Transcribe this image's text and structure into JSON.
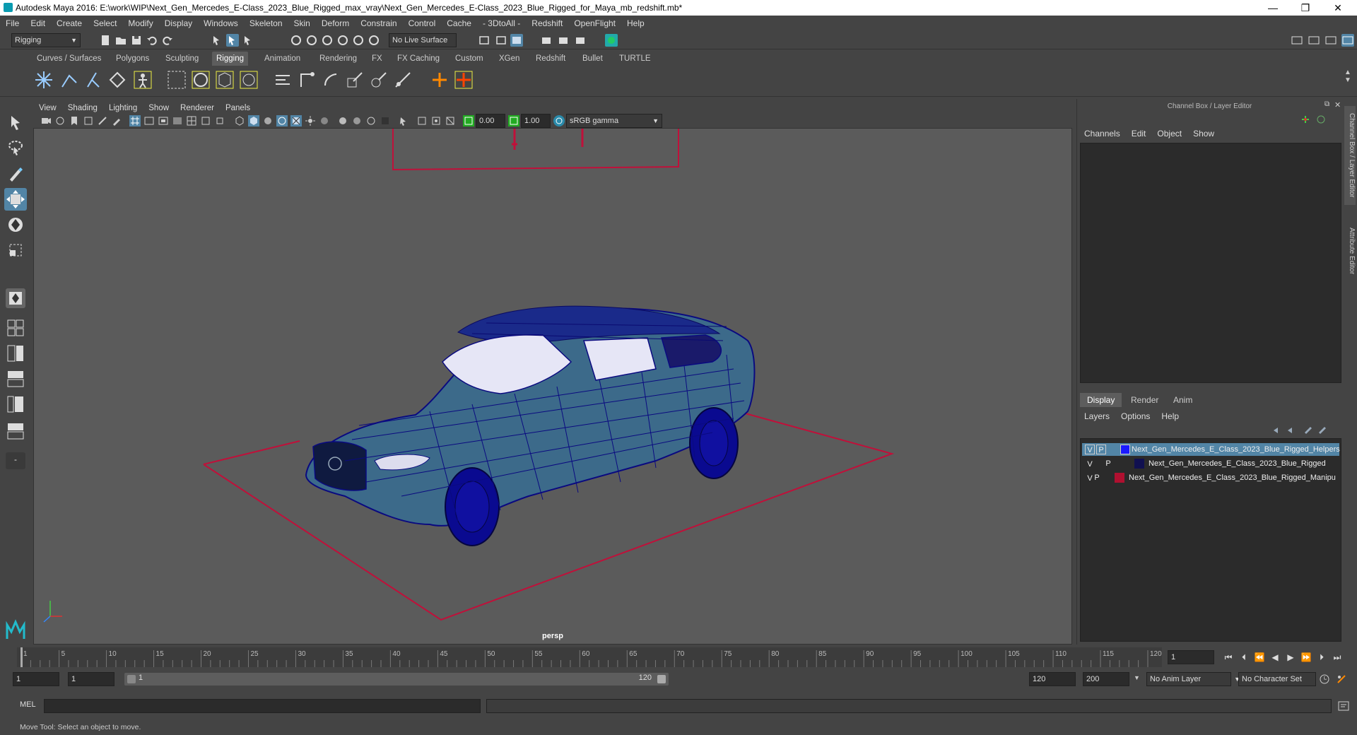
{
  "window": {
    "title": "Autodesk Maya 2016: E:\\work\\WIP\\Next_Gen_Mercedes_E-Class_2023_Blue_Rigged_max_vray\\Next_Gen_Mercedes_E-Class_2023_Blue_Rigged_for_Maya_mb_redshift.mb*",
    "minimize": "—",
    "restore": "❐",
    "close": "✕"
  },
  "menubar": [
    "File",
    "Edit",
    "Create",
    "Select",
    "Modify",
    "Display",
    "Windows",
    "Skeleton",
    "Skin",
    "Deform",
    "Constrain",
    "Control",
    "Cache",
    "- 3DtoAll -",
    "Redshift",
    "OpenFlight",
    "Help"
  ],
  "statusline": {
    "menuset": "Rigging",
    "live_surface": "No Live Surface"
  },
  "shelf_tabs": [
    "Curves / Surfaces",
    "Polygons",
    "Sculpting",
    "Rigging",
    "Animation",
    "Rendering",
    "FX",
    "FX Caching",
    "Custom",
    "XGen",
    "Redshift",
    "Bullet",
    "TURTLE"
  ],
  "shelf_active": "Rigging",
  "viewport": {
    "menu": [
      "View",
      "Shading",
      "Lighting",
      "Show",
      "Renderer",
      "Panels"
    ],
    "exposure": "0.00",
    "gamma": "1.00",
    "color_space": "sRGB gamma",
    "camera_label": "persp"
  },
  "right_panel": {
    "title": "Channel Box / Layer Editor",
    "channel_menu": [
      "Channels",
      "Edit",
      "Object",
      "Show"
    ],
    "layer_tabs": [
      "Display",
      "Render",
      "Anim"
    ],
    "layer_tab_active": "Display",
    "layer_menu": [
      "Layers",
      "Options",
      "Help"
    ],
    "layers": [
      {
        "v": "V",
        "p": "P",
        "color": "#1a1aff",
        "name": "Next_Gen_Mercedes_E_Class_2023_Blue_Rigged_Helpers",
        "selected": true
      },
      {
        "v": "V",
        "p": "P",
        "color": "#101050",
        "name": "Next_Gen_Mercedes_E_Class_2023_Blue_Rigged",
        "selected": false
      },
      {
        "v": "V",
        "p": "P",
        "color": "#b01030",
        "name": "Next_Gen_Mercedes_E_Class_2023_Blue_Rigged_Manipu",
        "selected": false
      }
    ]
  },
  "side_tabs": [
    "Channel Box / Layer Editor",
    "Attribute Editor"
  ],
  "timeline": {
    "ticks": [
      "1",
      "5",
      "10",
      "15",
      "20",
      "25",
      "30",
      "35",
      "40",
      "45",
      "50",
      "55",
      "60",
      "65",
      "70",
      "75",
      "80",
      "85",
      "90",
      "95",
      "100",
      "105",
      "110",
      "115",
      "120"
    ],
    "current_frame": "1"
  },
  "range": {
    "start": "1",
    "playback_start": "1",
    "slider_start": "1",
    "slider_end": "120",
    "playback_end": "120",
    "end": "200",
    "anim_layer": "No Anim Layer",
    "character_set": "No Character Set"
  },
  "command_line": {
    "label": "MEL"
  },
  "help_line": "Move Tool: Select an object to move.",
  "colors": {
    "selection": "#5285a6",
    "manipulator": "#c0103a",
    "mesh_fill": "#3c6a8a",
    "wireframe": "#0a0a80"
  }
}
